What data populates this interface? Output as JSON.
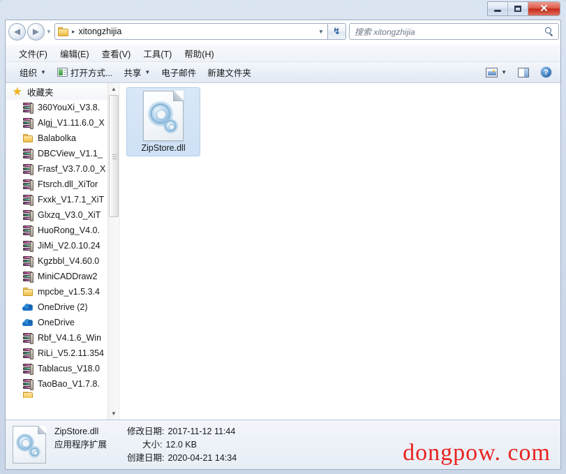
{
  "window": {
    "controls": {
      "minimize": "–",
      "maximize": "□",
      "close": "✕"
    }
  },
  "address": {
    "back_glyph": "◀",
    "forward_glyph": "▶",
    "history_caret": "▼",
    "folder_icon": "folder-icon",
    "separator": "▸",
    "path": "xitongzhijia",
    "dropdown_caret": "▼",
    "refresh_glyph": "↻"
  },
  "search": {
    "placeholder": "搜索 xitongzhijia",
    "value": ""
  },
  "menu": {
    "items": [
      {
        "label": "文件(F)"
      },
      {
        "label": "编辑(E)"
      },
      {
        "label": "查看(V)"
      },
      {
        "label": "工具(T)"
      },
      {
        "label": "帮助(H)"
      }
    ]
  },
  "toolbar": {
    "organize": "组织",
    "organize_caret": "▼",
    "open_with": "打开方式...",
    "share": "共享",
    "share_caret": "▼",
    "email": "电子邮件",
    "new_folder": "新建文件夹",
    "view_caret": "▼",
    "help_glyph": "?"
  },
  "sidebar": {
    "header": "收藏夹",
    "items": [
      {
        "label": "360YouXi_V3.8.",
        "icon": "archive-icon"
      },
      {
        "label": "Algj_V1.11.6.0_X",
        "icon": "archive-icon"
      },
      {
        "label": "Balabolka",
        "icon": "folder-icon"
      },
      {
        "label": "DBCView_V1.1_",
        "icon": "archive-icon"
      },
      {
        "label": "Frasf_V3.7.0.0_X",
        "icon": "archive-icon"
      },
      {
        "label": "Ftsrch.dll_XiTor",
        "icon": "archive-icon"
      },
      {
        "label": "Fxxk_V1.7.1_XiT",
        "icon": "archive-icon"
      },
      {
        "label": "Glxzq_V3.0_XiT",
        "icon": "archive-icon"
      },
      {
        "label": "HuoRong_V4.0.",
        "icon": "archive-icon"
      },
      {
        "label": "JiMi_V2.0.10.24",
        "icon": "archive-icon"
      },
      {
        "label": "Kgzbbl_V4.60.0",
        "icon": "archive-icon"
      },
      {
        "label": "MiniCADDraw2",
        "icon": "archive-icon"
      },
      {
        "label": "mpcbe_v1.5.3.4",
        "icon": "folder-icon"
      },
      {
        "label": "OneDrive (2)",
        "icon": "cloud-icon"
      },
      {
        "label": "OneDrive",
        "icon": "cloud-icon"
      },
      {
        "label": "Rbf_V4.1.6_Win",
        "icon": "archive-icon"
      },
      {
        "label": "RiLi_V5.2.11.354",
        "icon": "archive-icon"
      },
      {
        "label": "Tablacus_V18.0",
        "icon": "archive-icon"
      },
      {
        "label": "TaoBao_V1.7.8.",
        "icon": "archive-icon"
      }
    ],
    "scroll_up": "▲",
    "scroll_down": "▼"
  },
  "files": [
    {
      "name": "ZipStore.dll",
      "icon": "dll-icon",
      "selected": true
    }
  ],
  "details": {
    "name": "ZipStore.dll",
    "type": "应用程序扩展",
    "modified_label": "修改日期:",
    "modified_value": "2017-11-12 11:44",
    "size_label": "大小:",
    "size_value": "12.0 KB",
    "created_label": "创建日期:",
    "created_value": "2020-04-21 14:34"
  },
  "watermark": {
    "text": "dongpow. com",
    "color": "#e8231f"
  }
}
